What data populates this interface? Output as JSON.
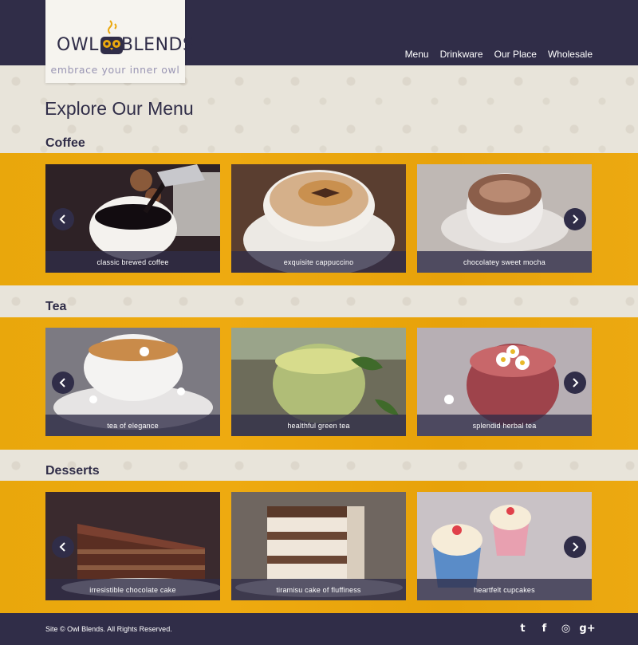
{
  "brand": {
    "name_left": "OWL",
    "name_right": "BLENDS",
    "tagline": "embrace your inner owl",
    "accent_color": "#eba80e",
    "dark_color": "#302d48"
  },
  "nav": {
    "items": [
      "Menu",
      "Drinkware",
      "Our Place",
      "Wholesale"
    ]
  },
  "page": {
    "title": "Explore Our Menu"
  },
  "sections": [
    {
      "heading": "Coffee",
      "cards": [
        {
          "caption": "classic brewed coffee"
        },
        {
          "caption": "exquisite cappuccino"
        },
        {
          "caption": "chocolatey sweet mocha"
        }
      ]
    },
    {
      "heading": "Tea",
      "cards": [
        {
          "caption": "tea of elegance"
        },
        {
          "caption": "healthful green tea"
        },
        {
          "caption": "splendid herbal tea"
        }
      ]
    },
    {
      "heading": "Desserts",
      "cards": [
        {
          "caption": "irresistible chocolate cake"
        },
        {
          "caption": "tiramisu cake of fluffiness"
        },
        {
          "caption": "heartfelt cupcakes"
        }
      ]
    }
  ],
  "footer": {
    "copyright": "Site © Owl Blends. All Rights Reserved.",
    "social_icons": [
      "twitter-icon",
      "facebook-icon",
      "instagram-icon",
      "google-plus-icon"
    ],
    "social_glyphs": [
      "t",
      "f",
      "◎",
      "g+"
    ]
  }
}
